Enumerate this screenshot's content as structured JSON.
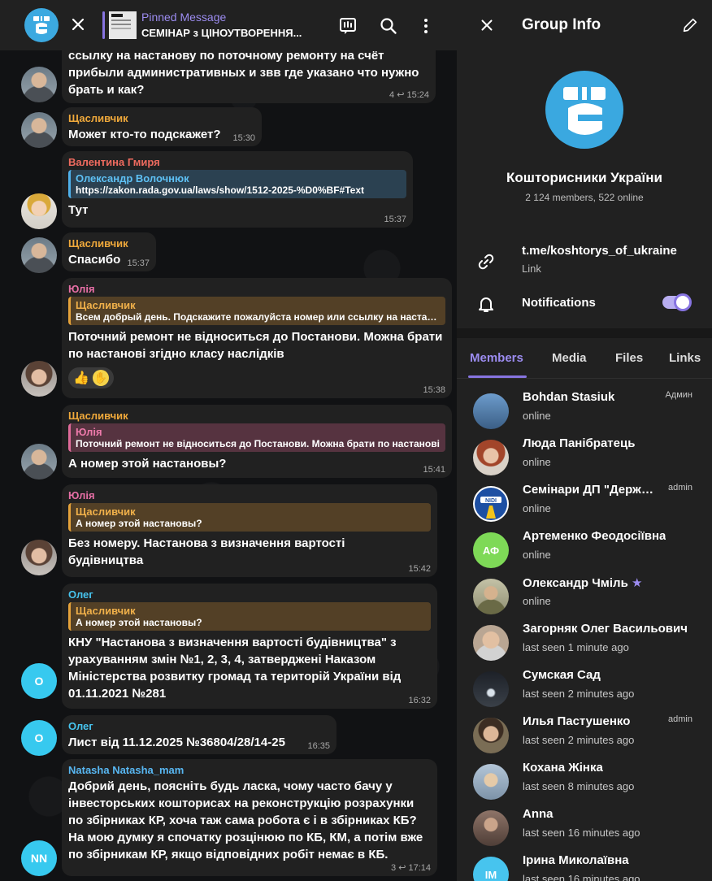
{
  "chat_header": {
    "pinned_title": "Pinned Message",
    "pinned_text": "СЕМІНАР з ЦІНОУТВОРЕННЯ..."
  },
  "messages": [
    {
      "text": "ссылку на настанову по поточному ремонту на счёт прибыли административных и звв где указано что нужно брать и как?",
      "replies": "4",
      "time": "15:24"
    },
    {
      "sender": "Щасливчик",
      "text": "Может кто-то подскажет?",
      "time": "15:30"
    },
    {
      "sender": "Валентина Гмиря",
      "quote_name": "Олександр Волочнюк",
      "quote_text": "https://zakon.rada.gov.ua/laws/show/1512-2025-%D0%BF#Text",
      "text": "Тут",
      "time": "15:37"
    },
    {
      "sender": "Щасливчик",
      "text": "Спасибо",
      "time": "15:37"
    },
    {
      "sender": "Юлія",
      "quote_name": "Щасливчик",
      "quote_text": "Всем добрый день. Подскажите пожалуйста номер или ссылку на настанову",
      "text": "Поточний ремонт не відноситься до Постанови. Можна брати по настанові згідно класу наслідків",
      "reaction": "👍",
      "time": "15:38"
    },
    {
      "sender": "Щасливчик",
      "quote_name": "Юлія",
      "quote_text": "Поточний ремонт не відноситься до Постанови. Можна брати по настанові",
      "text": "А номер этой настановы?",
      "time": "15:41"
    },
    {
      "sender": "Юлія",
      "quote_name": "Щасливчик",
      "quote_text": "А номер этой настановы?",
      "text": "Без номеру. Настанова з визначення вартості будівництва",
      "time": "15:42"
    },
    {
      "sender": "Олег",
      "quote_name": "Щасливчик",
      "quote_text": "А номер этой настановы?",
      "text": "КНУ \"Настанова з визначення вартості будівництва\" з урахуванням змін №1, 2, 3, 4, затверджені Наказом Міністерства розвитку громад та територій України від 01.11.2021 №281",
      "time": "16:32",
      "avatar": "O"
    },
    {
      "sender": "Олег",
      "text": "Лист від 11.12.2025 №36804/28/14-25",
      "time": "16:35",
      "avatar": "O"
    },
    {
      "sender": "Natasha Natasha_mam",
      "text": "Добрий день, поясніть будь ласка, чому часто бачу у інвесторських кошторисах на реконструкцію розрахунки по збірниках КР, хоча таж сама робота є і в збірниках КБ? На мою думку я спочатку розцінюю по КБ, КМ, а потім вже по збірникам КР, якщо відповідних робіт немає в КБ.",
      "replies": "3",
      "time": "17:14",
      "avatar": "NN"
    }
  ],
  "panel": {
    "title": "Group Info",
    "group_name": "Кошторисники України",
    "group_sub": "2 124 members, 522 online",
    "link": "t.me/koshtorys_of_ukraine",
    "link_label": "Link",
    "notifications": "Notifications",
    "tabs": [
      "Members",
      "Media",
      "Files",
      "Links"
    ],
    "members": [
      {
        "name": "Bohdan Stasiuk",
        "status": "online",
        "role": "Админ",
        "color": "#5a8fc4"
      },
      {
        "name": "Люда Панібратець",
        "status": "online",
        "role": "",
        "color": "#b55a3c"
      },
      {
        "name": "Семінари ДП \"Державний науково-дослідний інститут\"",
        "status": "online",
        "role": "admin",
        "color": "#ffffff"
      },
      {
        "name": "Артеменко Феодосіївна",
        "status": "online",
        "role": "",
        "color": "#7ed957",
        "initials": "АФ"
      },
      {
        "name": "Олександр Чміль",
        "status": "online",
        "role": "",
        "color": "#8a8a6a",
        "star": "★"
      },
      {
        "name": "Загорняк Олег Васильович",
        "status": "last seen 1 minute ago",
        "role": "",
        "color": "#c9b8a6"
      },
      {
        "name": "Сумская Сад",
        "status": "last seen 2 minutes ago",
        "role": "",
        "color": "#2b3038"
      },
      {
        "name": "Илья Пастушенко",
        "status": "last seen 2 minutes ago",
        "role": "admin",
        "color": "#6a6048"
      },
      {
        "name": "Кохана Жінка",
        "status": "last seen 8 minutes ago",
        "role": "",
        "color": "#8aa0b8"
      },
      {
        "name": "Anna",
        "status": "last seen 16 minutes ago",
        "role": "",
        "color": "#705a52"
      },
      {
        "name": "Ірина Миколаївна",
        "status": "last seen 16 minutes ago",
        "role": "",
        "color": "#47c4ee",
        "initials": "IM"
      }
    ]
  }
}
